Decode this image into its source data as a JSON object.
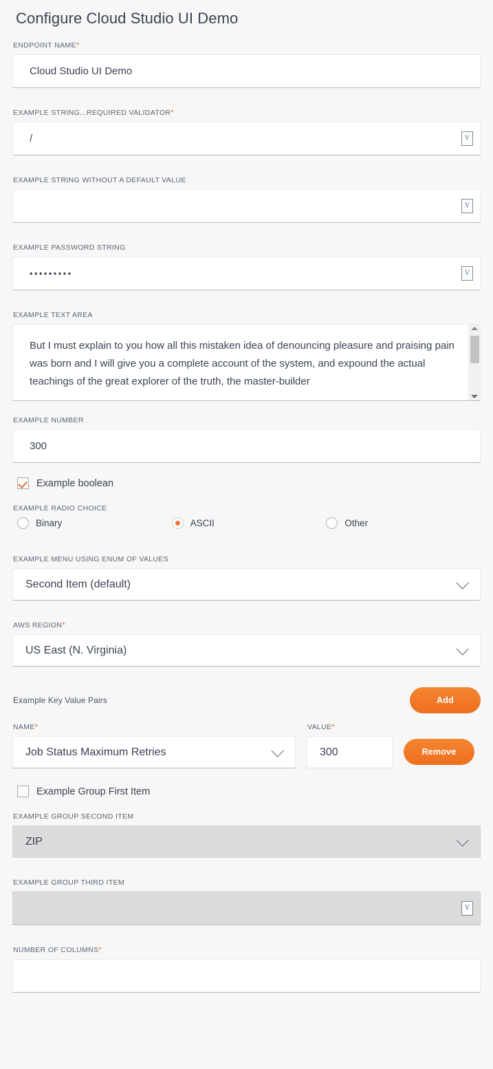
{
  "page": {
    "title": "Configure Cloud Studio UI Demo",
    "accent_color": "#ee6f21",
    "background_color": "#f7f7f7",
    "required_marker": "*"
  },
  "fields": {
    "endpoint_name": {
      "label": "ENDPOINT NAME",
      "required": true,
      "value": "Cloud Studio UI Demo"
    },
    "example_string_required": {
      "label": "EXAMPLE STRING...REQUIRED VALIDATOR",
      "required": true,
      "value": "/",
      "token_button": "V"
    },
    "example_string_no_default": {
      "label": "EXAMPLE STRING WITHOUT A DEFAULT VALUE",
      "required": false,
      "value": "",
      "token_button": "V"
    },
    "example_password": {
      "label": "EXAMPLE PASSWORD STRING",
      "required": false,
      "value": "•••••••••",
      "token_button": "V"
    },
    "example_text_area": {
      "label": "EXAMPLE TEXT AREA",
      "required": false,
      "value": "But I must explain to you how all this mistaken idea of denouncing pleasure and praising pain was born and I will give you a complete account of the system, and expound the actual teachings of the great explorer of the truth, the master-builder"
    },
    "example_number": {
      "label": "EXAMPLE NUMBER",
      "required": false,
      "value": "300"
    },
    "example_boolean": {
      "label": "Example boolean",
      "checked": true
    },
    "example_radio_choice": {
      "label": "EXAMPLE RADIO CHOICE",
      "options": [
        {
          "label": "Binary",
          "selected": false
        },
        {
          "label": "ASCII",
          "selected": true
        },
        {
          "label": "Other",
          "selected": false
        }
      ]
    },
    "example_menu_enum": {
      "label": "EXAMPLE MENU USING ENUM OF VALUES",
      "required": false,
      "value": "Second Item (default)"
    },
    "aws_region": {
      "label": "AWS REGION",
      "required": true,
      "value": "US East (N. Virginia)"
    },
    "key_value_pairs": {
      "label": "Example Key Value Pairs",
      "add_label": "Add",
      "remove_label": "Remove",
      "name_label": "NAME",
      "name_required": true,
      "value_label": "VALUE",
      "value_required": true,
      "rows": [
        {
          "name": "Job Status Maximum Retries",
          "value": "300"
        }
      ]
    },
    "example_group_first": {
      "label": "Example Group First Item",
      "checked": false
    },
    "example_group_second": {
      "label": "EXAMPLE GROUP SECOND ITEM",
      "required": false,
      "value": "ZIP",
      "disabled": true
    },
    "example_group_third": {
      "label": "EXAMPLE GROUP THIRD ITEM",
      "required": false,
      "value": "",
      "disabled": true,
      "token_button": "V"
    },
    "number_of_columns": {
      "label": "NUMBER OF COLUMNS",
      "required": true,
      "value": ""
    }
  }
}
